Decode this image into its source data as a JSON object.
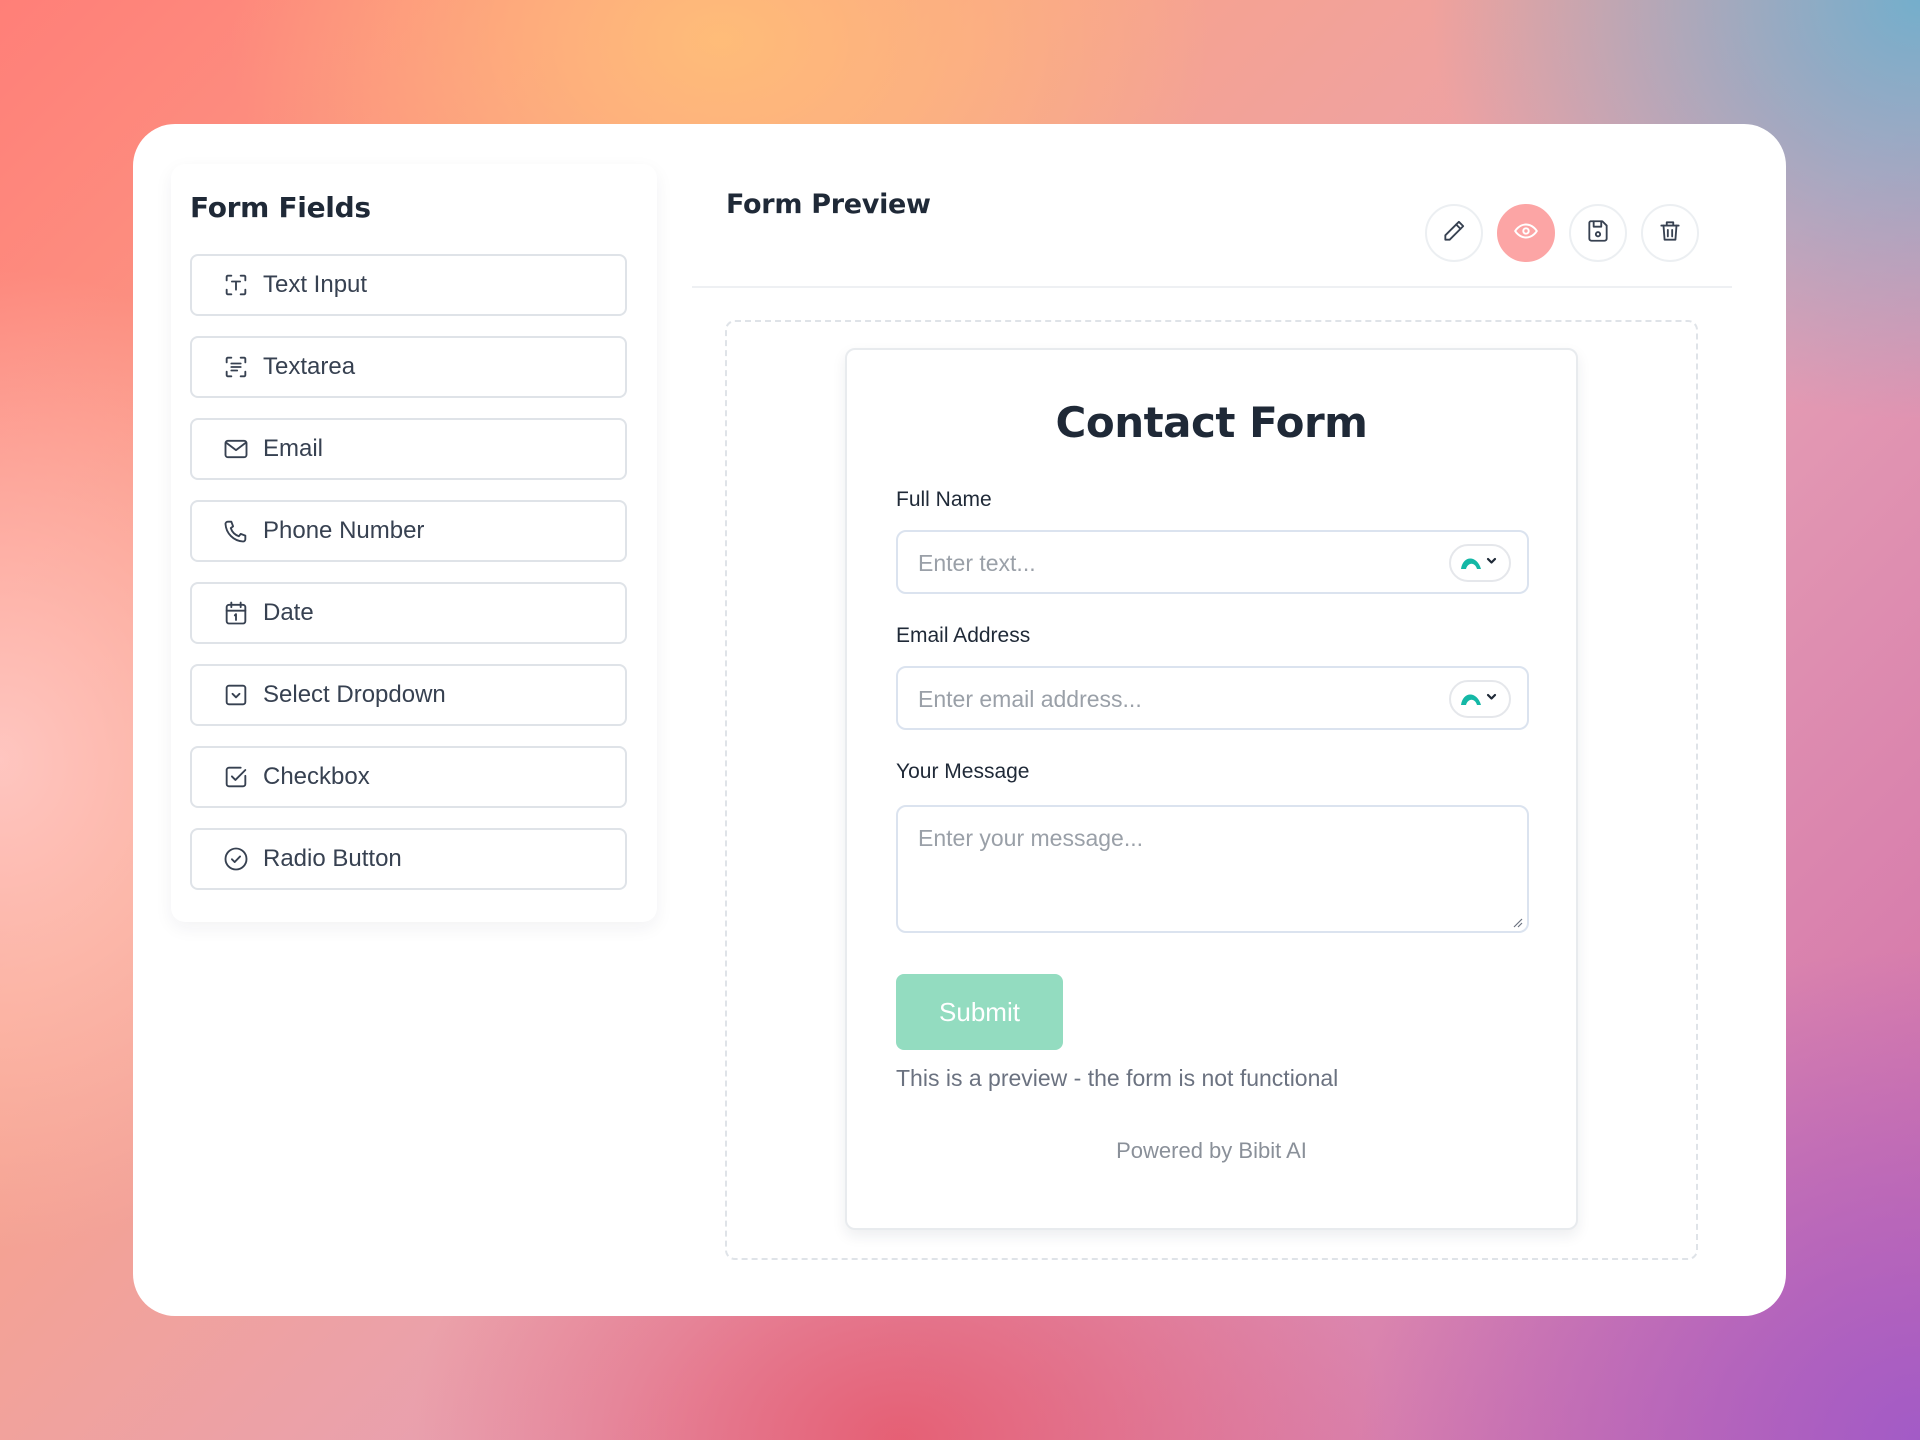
{
  "sidebar": {
    "title": "Form Fields",
    "items": [
      {
        "label": "Text Input",
        "icon": "text-input-icon"
      },
      {
        "label": "Textarea",
        "icon": "textarea-icon"
      },
      {
        "label": "Email",
        "icon": "mail-icon"
      },
      {
        "label": "Phone Number",
        "icon": "phone-icon"
      },
      {
        "label": "Date",
        "icon": "calendar-icon"
      },
      {
        "label": "Select Dropdown",
        "icon": "select-icon"
      },
      {
        "label": "Checkbox",
        "icon": "checkbox-icon"
      },
      {
        "label": "Radio Button",
        "icon": "radio-icon"
      }
    ]
  },
  "preview": {
    "title": "Form Preview",
    "toolbar": [
      {
        "icon": "pencil-icon",
        "active": false
      },
      {
        "icon": "eye-icon",
        "active": true
      },
      {
        "icon": "save-icon",
        "active": false
      },
      {
        "icon": "trash-icon",
        "active": false
      }
    ]
  },
  "form": {
    "title": "Contact Form",
    "fields": [
      {
        "label": "Full Name",
        "placeholder": "Enter text..."
      },
      {
        "label": "Email Address",
        "placeholder": "Enter email address..."
      },
      {
        "label": "Your Message",
        "placeholder": "Enter your message..."
      }
    ],
    "submit_label": "Submit",
    "note": "This is a preview - the form is not functional",
    "powered_by": "Powered by Bibit AI"
  },
  "colors": {
    "accent_active": "#fca5a5",
    "submit": "#93dcc0",
    "assist_icon": "#14b8a6"
  }
}
